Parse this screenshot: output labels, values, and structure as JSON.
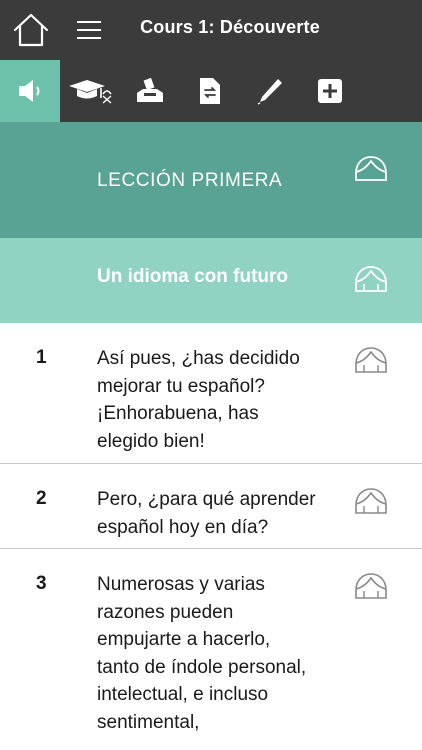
{
  "topbar": {
    "title": "Cours 1: Découverte",
    "home_icon": "home-icon",
    "menu_icon": "hamburger-menu-icon"
  },
  "toolbar": {
    "tools": [
      {
        "icon": "speaker-icon",
        "active": true
      },
      {
        "icon": "graduation-cap-icon",
        "active": false
      },
      {
        "icon": "inbox-tray-icon",
        "active": false
      },
      {
        "icon": "document-swap-icon",
        "active": false
      },
      {
        "icon": "pen-icon",
        "active": false
      },
      {
        "icon": "plus-box-icon",
        "active": false
      }
    ]
  },
  "lesson": {
    "title": "LECCIÓN PRIMERA"
  },
  "section": {
    "title": "Un idioma con futuro"
  },
  "rows": [
    {
      "num": "1",
      "lines": [
        "Así pues, ¿has decidido",
        "mejorar tu español?",
        "¡Enhorabuena, has",
        "elegido bien!"
      ]
    },
    {
      "num": "2",
      "lines": [
        "Pero, ¿para qué aprender",
        "español hoy en día?"
      ]
    },
    {
      "num": "3",
      "lines": [
        "Numerosas y varias",
        "razones pueden",
        "empujarte a hacerlo,",
        "tanto de índole personal,",
        "intelectual, e incluso",
        "sentimental,"
      ]
    }
  ],
  "colors": {
    "bar": "#3b3b3b",
    "active_tab": "#6dc1ab",
    "lesson_header": "#58a393",
    "section_header": "#90d3c3"
  }
}
